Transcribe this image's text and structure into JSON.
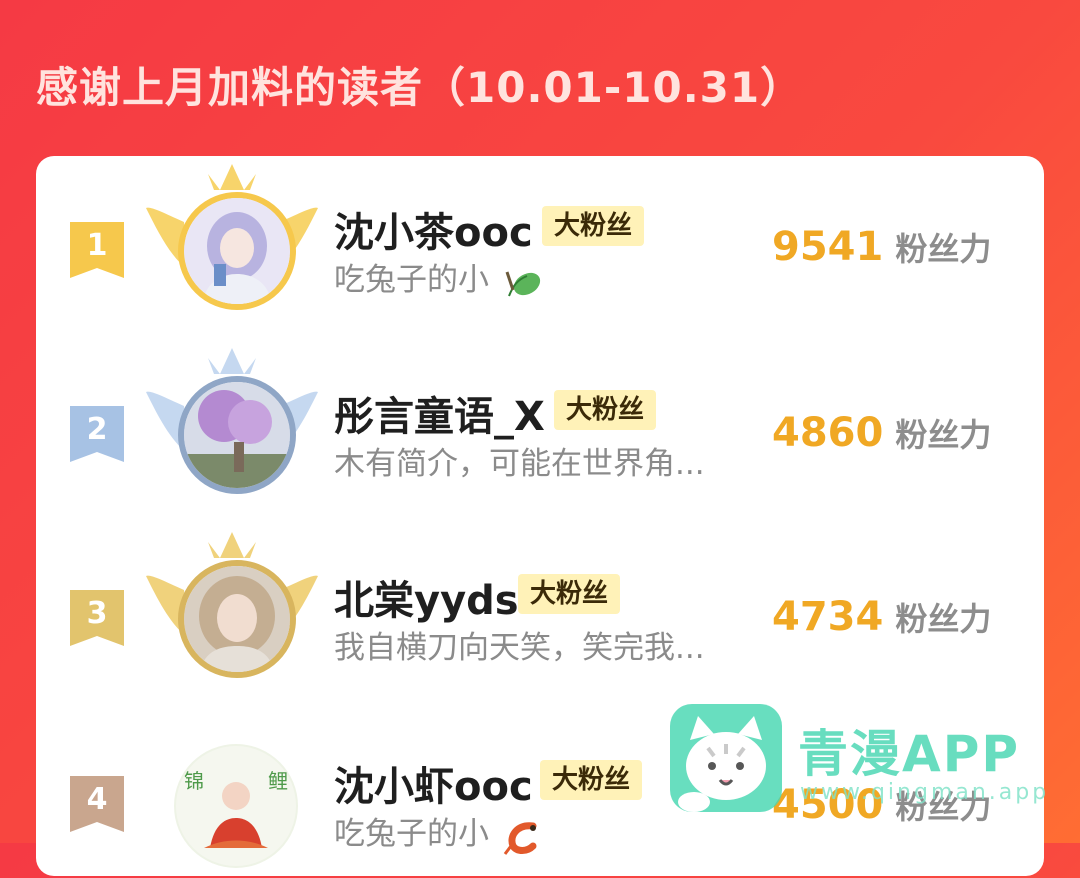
{
  "header": {
    "title": "感谢上月加料的读者（10.01-10.31）"
  },
  "colors": {
    "gold": "#f6c84c",
    "silver_blue": "#a7c2e4",
    "bronze": "#e8c566",
    "rank4": "#c9a68e",
    "points": "#f0a824",
    "badge_bg": "#fff2b8"
  },
  "readers": [
    {
      "rank": "1",
      "name": "沈小茶ooc",
      "badge": "大粉丝",
      "desc": "吃兔子的小",
      "desc_icon": "tea-leaf-icon",
      "points": "9541",
      "unit": "粉丝力"
    },
    {
      "rank": "2",
      "name": "彤言童语_X",
      "badge": "大粉丝",
      "desc": "木有简介，可能在世界角...",
      "points": "4860",
      "unit": "粉丝力"
    },
    {
      "rank": "3",
      "name": "北棠yyds",
      "badge": "大粉丝",
      "desc": "我自横刀向天笑，笑完我...",
      "points": "4734",
      "unit": "粉丝力"
    },
    {
      "rank": "4",
      "name": "沈小虾ooc",
      "badge": "大粉丝",
      "desc": "吃兔子的小",
      "desc_icon": "shrimp-icon",
      "points": "4500",
      "unit": "粉丝力"
    }
  ],
  "watermark": {
    "name": "青漫APP",
    "url": "www.qingman.app",
    "icon": "cat-icon"
  }
}
